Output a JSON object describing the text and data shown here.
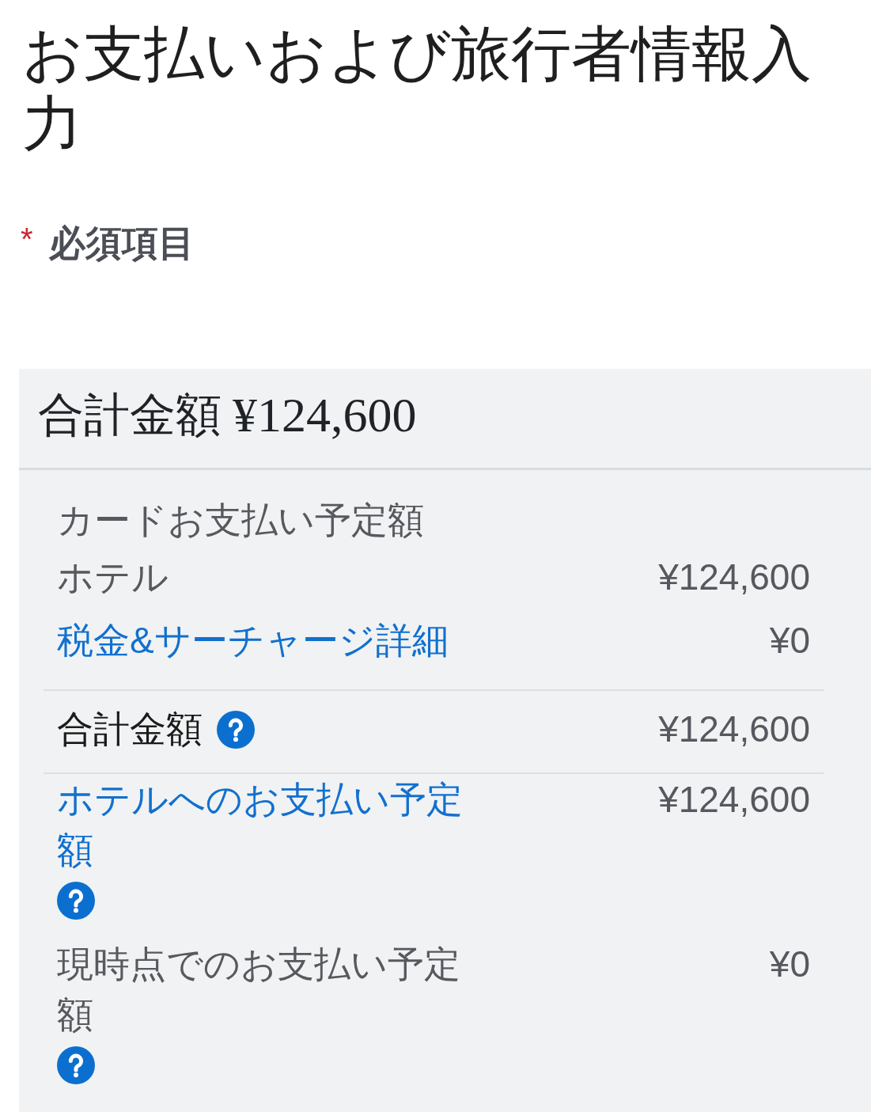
{
  "page_title": "お支払いおよび旅行者情報入力",
  "required_note": {
    "marker": "*",
    "label": "必須項目"
  },
  "summary": {
    "title": "合計金額",
    "total": "¥124,600",
    "section_heading": "カードお支払い予定額",
    "rows": [
      {
        "kind": "plain",
        "label": "ホテル",
        "amount": "¥124,600"
      },
      {
        "kind": "link",
        "label": "税金&サーチャージ詳細",
        "amount": "¥0"
      },
      {
        "kind": "total",
        "label": "合計金額",
        "amount": "¥124,600",
        "help": true
      },
      {
        "kind": "link",
        "label": "ホテルへのお支払い予定額",
        "amount": "¥124,600",
        "help": true
      },
      {
        "kind": "plain",
        "label": "現時点でのお支払い予定額",
        "amount": "¥0",
        "help": true
      }
    ]
  }
}
